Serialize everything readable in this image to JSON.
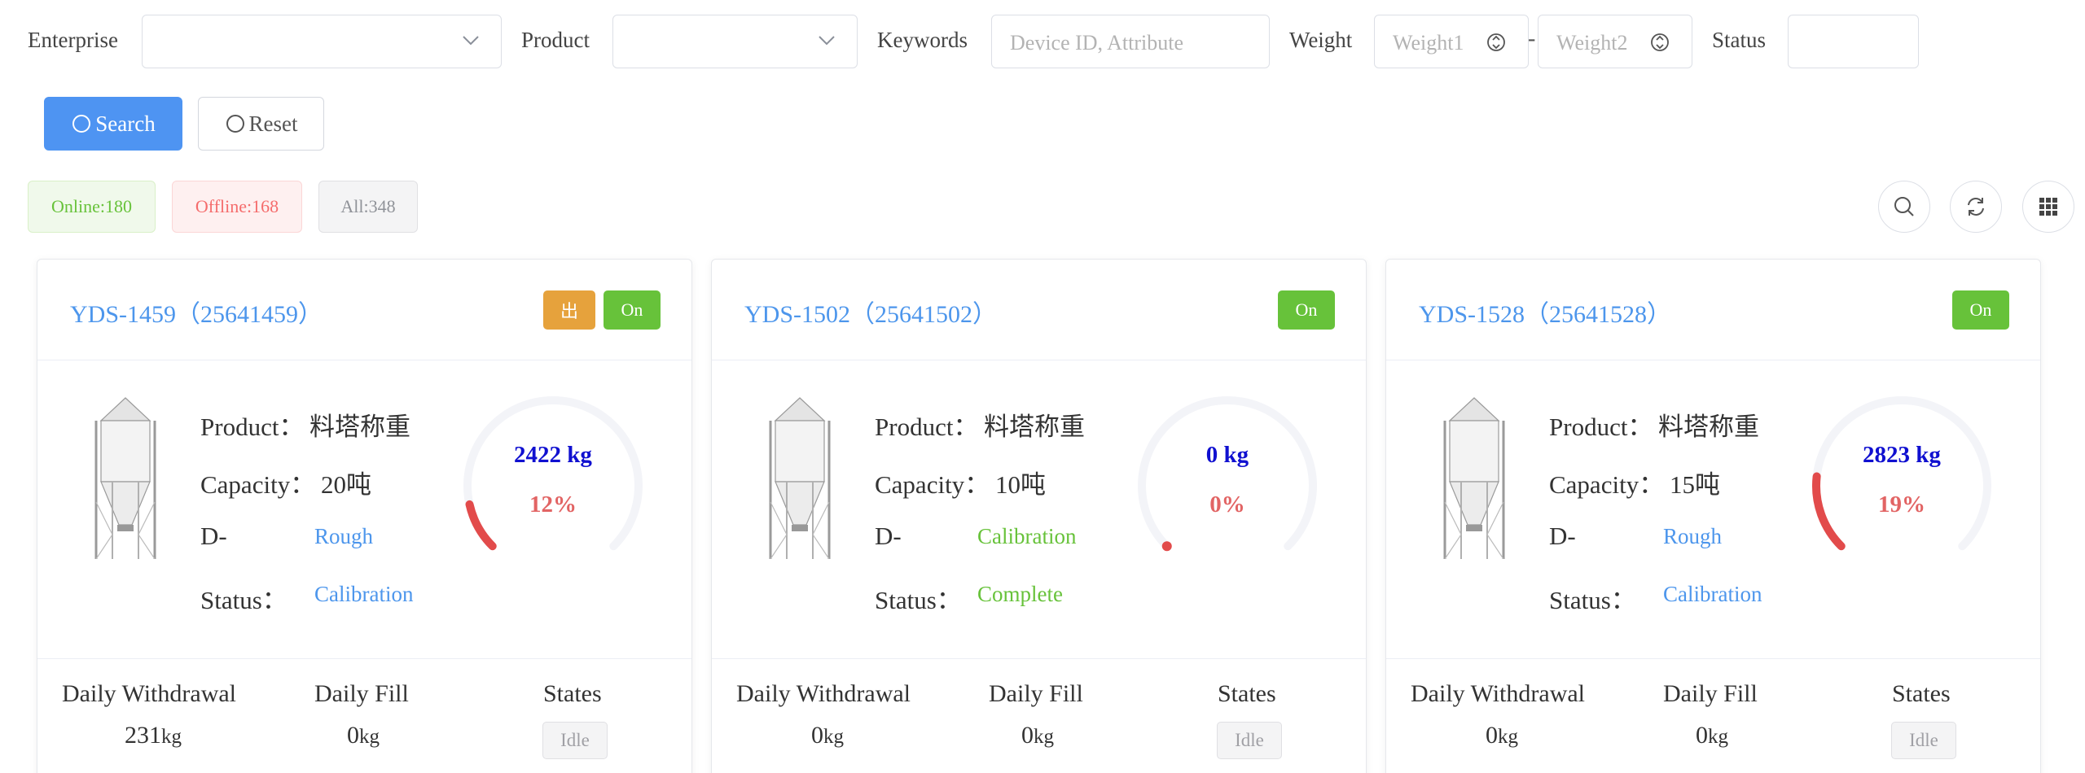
{
  "filters": {
    "enterprise_label": "Enterprise",
    "product_label": "Product",
    "keywords_label": "Keywords",
    "keywords_placeholder": "Device ID, Attribute",
    "weight_label": "Weight",
    "weight1_placeholder": "Weight1",
    "weight_separator": "-",
    "weight2_placeholder": "Weight2",
    "status_label": "Status"
  },
  "actions": {
    "search_label": "Search",
    "reset_label": "Reset"
  },
  "summary_tags": {
    "online": "Online:180",
    "offline": "Offline:168",
    "all": "All:348"
  },
  "labels": {
    "product": "Product：",
    "capacity": "Capacity：",
    "d": "D-",
    "status": "Status：",
    "daily_withdrawal": "Daily Withdrawal",
    "daily_fill": "Daily Fill",
    "states": "States",
    "unit": "kg"
  },
  "devices": [
    {
      "title": "YDS-1459（25641459）",
      "badge_out": "出",
      "badge_on": "On",
      "product": "料塔称重",
      "capacity": "20吨",
      "d_value": "Rough",
      "status_value": "Calibration",
      "weight": "2422 kg",
      "percent_label": "12%",
      "fill_fraction": 0.12,
      "daily_withdrawal": "231",
      "daily_fill": "0",
      "state": "Idle"
    },
    {
      "title": "YDS-1502（25641502）",
      "badge_on": "On",
      "product": "料塔称重",
      "capacity": "10吨",
      "d_value": "Calibration",
      "status_value": "Complete",
      "weight": "0 kg",
      "percent_label": "0%",
      "fill_fraction": 0,
      "daily_withdrawal": "0",
      "daily_fill": "0",
      "state": "Idle"
    },
    {
      "title": "YDS-1528（25641528）",
      "badge_on": "On",
      "product": "料塔称重",
      "capacity": "15吨",
      "d_value": "Rough",
      "status_value": "Calibration",
      "weight": "2823 kg",
      "percent_label": "19%",
      "fill_fraction": 0.19,
      "daily_withdrawal": "0",
      "daily_fill": "0",
      "state": "Idle"
    }
  ],
  "colors": {
    "primary": "#4e94f2",
    "online": "#67c23a",
    "offline": "#f56c6c",
    "warning": "#e6a23c",
    "gauge_fill": "#e24b4b",
    "gauge_track": "#f3f4f8",
    "weight_text": "#1010d0"
  }
}
